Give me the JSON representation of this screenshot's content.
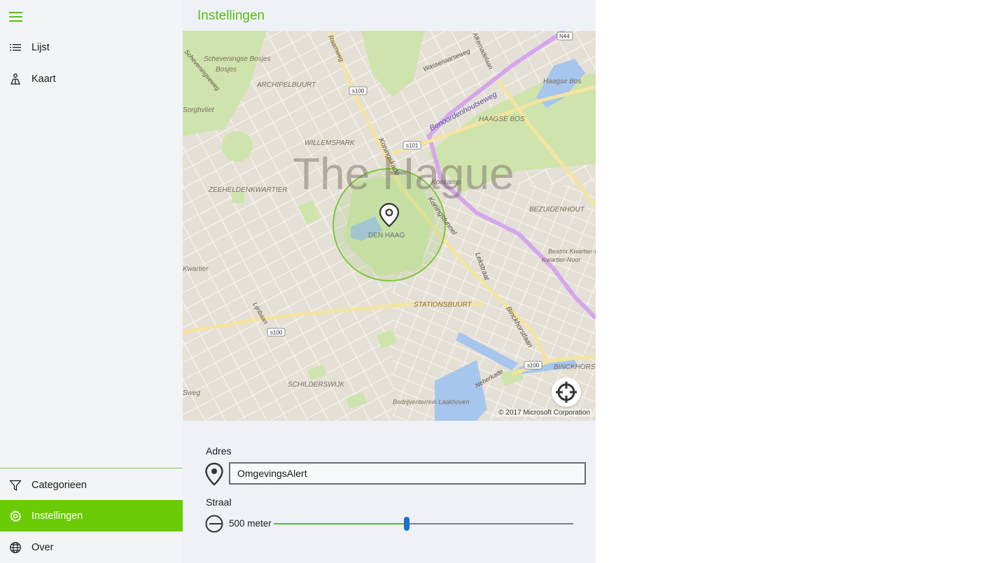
{
  "sidebar": {
    "top_items": [
      {
        "label": "Lijst",
        "icon": "list-icon"
      },
      {
        "label": "Kaart",
        "icon": "map-person-icon"
      }
    ],
    "bottom_items": [
      {
        "label": "Categorieen",
        "icon": "filter-icon"
      },
      {
        "label": "Instellingen",
        "icon": "gear-icon",
        "active": true
      },
      {
        "label": "Over",
        "icon": "globe-icon"
      }
    ]
  },
  "header": {
    "title": "Instellingen"
  },
  "map": {
    "city_label": "The Hague",
    "pin_label": "DEN HAAG",
    "copyright": "© 2017 Microsoft Corporation",
    "labels": [
      "Scheveningse Bosjes",
      "ARCHIPELBUURT",
      "Sorghvliet",
      "WILLEMSPARK",
      "ZEEHELDENKWARTIER",
      "HAAGSE BOS",
      "Haagse Bos",
      "Benoordenhoutseweg",
      "Koningskade",
      "Koningstunnel",
      "Koekamp",
      "BEZUIDENHOUT",
      "Lekstraat",
      "STATIONSBUURT",
      "Binckhorstlaan",
      "BINCKHORST",
      "SCHILDERSWIJK",
      "Bedrijventerrein Laakhoven",
      "Beatrix Kwartier-Noord",
      "Raamweg",
      "Wassenaarseweg",
      "Alkemadelaan",
      "Bosjes",
      "Scheveningseweg",
      "Lijnbaan",
      "Neherkade",
      "Kwartier",
      "Sweg",
      "s100",
      "s101",
      "N44",
      "Kwartier-Noor"
    ],
    "colors": {
      "park": "#cfe4ad",
      "water": "#a7c6ed",
      "road": "#ffffff",
      "highway": "#f6e7a5",
      "tunnel": "#d4a7ec",
      "radius": "#7ec63b"
    }
  },
  "form": {
    "address_label": "Adres",
    "address_value": "OmgevingsAlert",
    "radius_label": "Straal",
    "radius_value": "500 meter",
    "radius_fraction": 0.445
  },
  "accent_color": "#6bcb05"
}
